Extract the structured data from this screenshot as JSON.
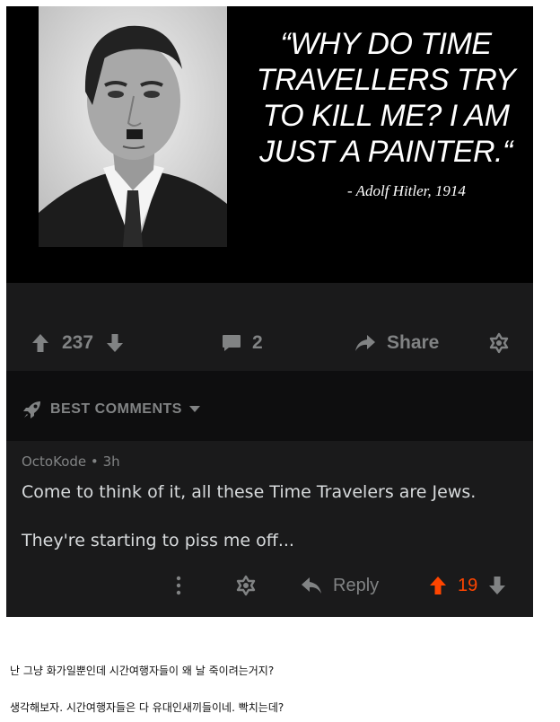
{
  "post": {
    "quote_lines": [
      "“WHY DO TIME",
      "TRAVELLERS TRY",
      "TO KILL ME? I AM",
      "JUST A PAINTER.“"
    ],
    "attribution": "- Adolf Hitler, 1914",
    "upvote_count": "237",
    "comment_count": "2",
    "share_label": "Share"
  },
  "best_comments": {
    "label": "BEST COMMENTS"
  },
  "comment": {
    "author": "OctoKode",
    "separator": "•",
    "age": "3h",
    "line1": "Come to think of it, all these Time Travelers are Jews.",
    "line2": "They're starting to piss me off...",
    "reply_label": "Reply",
    "vote_count": "19"
  },
  "captions": {
    "line1": "난 그냥 화가일뿐인데 시간여행자들이 왜 날 죽이려는거지?",
    "line2": "생각해보자. 시간여행자들은 다 유대인새끼들이네. 빡치는데?"
  },
  "colors": {
    "upvote_active": "#ff4500",
    "muted": "#818384",
    "card_bg": "#1a1a1b"
  }
}
